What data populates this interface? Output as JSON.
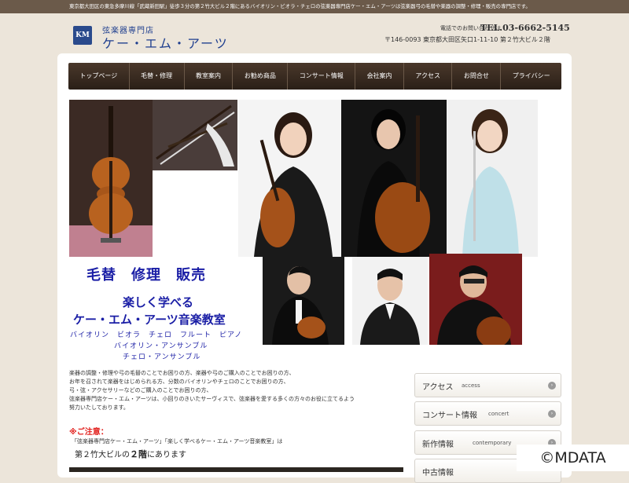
{
  "topbar": {
    "text": "東京都大田区の東急多摩川線「武蔵新田駅」徒歩３分の第２竹大ビル２階にあるバイオリン・ビオラ・チェロの弦楽器専門店ケー・エム・アーツは弦楽器弓の毛替や楽器の調整・修理・販売の専門店です。"
  },
  "header": {
    "logo_mark": "KM",
    "logo_sub": "弦楽器専門店",
    "logo_name": "ケー・エム・アーツ",
    "contact_note": "電話でのお問い合わせは",
    "tel": "TEL.03-6662-5145",
    "address": "〒146-0093 東京都大田区矢口1-11-10 第２竹大ビル２階"
  },
  "nav": {
    "items": [
      {
        "label": "トップページ"
      },
      {
        "label": "毛替・修理"
      },
      {
        "label": "教室案内"
      },
      {
        "label": "お勧め商品"
      },
      {
        "label": "コンサート情報"
      },
      {
        "label": "会社案内"
      },
      {
        "label": "アクセス"
      },
      {
        "label": "お問合せ"
      },
      {
        "label": "プライバシー"
      }
    ]
  },
  "hero": {
    "line1": "毛替　修理　販売",
    "line2": "楽しく学べる",
    "line3": "ケー・エム・アーツ音楽教室",
    "line4": "バイオリン　ビオラ　チェロ　フルート　ピアノ",
    "line5": "バイオリン・アンサンブル",
    "line6": "チェロ・アンサンブル"
  },
  "intro": {
    "lines": [
      "楽器の調整・修理や弓の毛替のことでお困りの方、楽器や弓のご購入のことでお困りの方、",
      "お年を召されて楽器をはじめられる方、分数のバイオリンやチェロのことでお困りの方、",
      "弓・弦・アクセサリーなどのご購入のことでお困りの方、",
      "弦楽器専門店ケー・エム・アーツは、小回りのきいたサーヴィスで、弦楽器を愛する多くの方々のお役に立てるよう",
      "努力いたしております。"
    ]
  },
  "notice": {
    "title": "※ご注意：",
    "line": "「弦楽器専門店ケー・エム・アーツ」「楽しく学べるケー・エム・アーツ音楽教室」は",
    "big_prefix": "第２竹大ビルの",
    "big_bold": "２階",
    "big_suffix": "にあります"
  },
  "sidebar": {
    "items": [
      {
        "jp": "アクセス",
        "en": "access"
      },
      {
        "jp": "コンサート情報",
        "en": "concert"
      },
      {
        "jp": "新作情報",
        "en": "contemporary"
      },
      {
        "jp": "中古情報",
        "en": ""
      }
    ],
    "arrow": "›"
  },
  "copyright": "©MDATA"
}
